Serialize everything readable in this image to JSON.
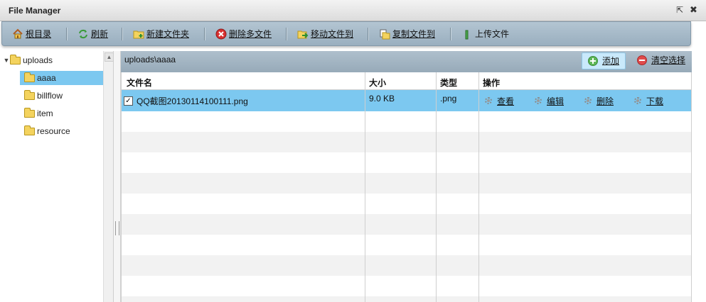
{
  "window": {
    "title": "File Manager"
  },
  "toolbar": {
    "root": "根目录",
    "refresh": "刷新",
    "new_folder": "新建文件夹",
    "delete_files": "删除多文件",
    "move_files": "移动文件到",
    "copy_files": "复制文件到",
    "upload": "上传文件"
  },
  "tree": {
    "root": "uploads",
    "children": [
      "aaaa",
      "billflow",
      "item",
      "resource"
    ],
    "selected": "aaaa"
  },
  "content": {
    "path": "uploads\\aaaa",
    "add_label": "添加",
    "clear_label": "清空选择"
  },
  "grid": {
    "columns": [
      "文件名",
      "大小",
      "类型",
      "操作"
    ],
    "rows": [
      {
        "name": "QQ截图20130114100111.png",
        "size": "9.0 KB",
        "type": ".png",
        "checked": true
      }
    ],
    "actions": [
      "查看",
      "编辑",
      "删除",
      "下载"
    ]
  },
  "colors": {
    "selection": "#7cc8f0",
    "toolbar": "#a9bccb"
  }
}
